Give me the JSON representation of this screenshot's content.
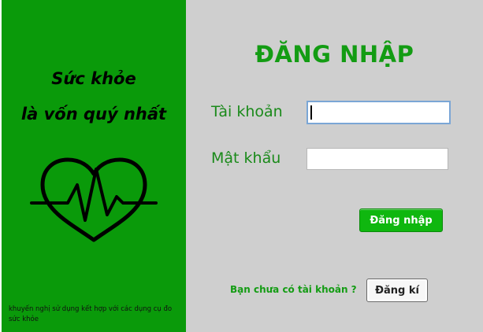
{
  "left": {
    "slogan_line1": "Sức khỏe",
    "slogan_line2": "là vốn quý nhất",
    "heart_icon": "heart-pulse-icon",
    "note": "khuyến nghị sử dụng kết hợp với các dụng cụ đo sức khỏe"
  },
  "form": {
    "title": "ĐĂNG NHẬP",
    "username_label": "Tài khoản",
    "username_value": "",
    "password_label": "Mật khẩu",
    "password_value": "",
    "login_button": "Đăng nhập",
    "no_account_text": "Bạn chưa có tài khoản ?",
    "register_button": "Đăng kí"
  },
  "colors": {
    "left_bg": "#0a9a0a",
    "right_bg": "#cfcfcf",
    "accent": "#139c13"
  }
}
